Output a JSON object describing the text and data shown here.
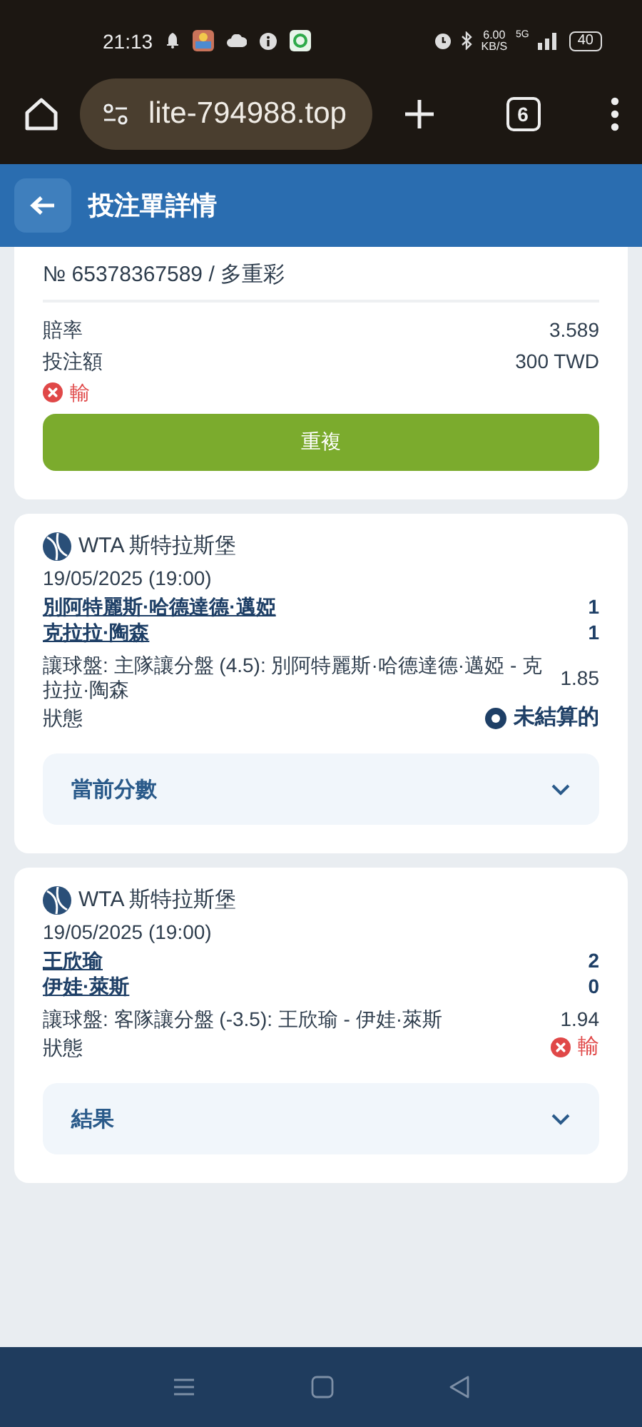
{
  "status_bar": {
    "time": "21:13",
    "speed": "6.00",
    "speed_unit": "KB/S",
    "network": "5G",
    "battery": "40"
  },
  "browser": {
    "url": "lite-794988.top",
    "tab_count": "6"
  },
  "header": {
    "title": "投注單詳情"
  },
  "summary": {
    "number": "№ 65378367589 / 多重彩",
    "rows": [
      {
        "label": "賠率",
        "value": "3.589"
      },
      {
        "label": "投注額",
        "value": "300 TWD"
      }
    ],
    "result": {
      "kind": "lost",
      "text": "輸"
    },
    "button": "重複"
  },
  "events": [
    {
      "league": "WTA 斯特拉斯堡",
      "date": "19/05/2025 (19:00)",
      "teams": [
        {
          "name": "別阿特麗斯·哈德達德·邁婭",
          "score": "1"
        },
        {
          "name": "克拉拉·陶森",
          "score": "1"
        }
      ],
      "market": "讓球盤: 主隊讓分盤 (4.5): 別阿特麗斯·哈德達德·邁婭 - 克拉拉·陶森",
      "odds": "1.85",
      "status_label": "狀態",
      "status": {
        "kind": "unsettled",
        "text": "未結算的"
      },
      "expander": {
        "label": "當前分數",
        "expanded": false
      }
    },
    {
      "league": "WTA 斯特拉斯堡",
      "date": "19/05/2025 (19:00)",
      "teams": [
        {
          "name": "王欣瑜",
          "score": "2"
        },
        {
          "name": "伊娃·萊斯",
          "score": "0"
        }
      ],
      "market": "讓球盤: 客隊讓分盤 (-3.5): 王欣瑜 - 伊娃·萊斯",
      "odds": "1.94",
      "status_label": "狀態",
      "status": {
        "kind": "lost",
        "text": "輸"
      },
      "expander": {
        "label": "結果",
        "expanded": false
      }
    }
  ]
}
